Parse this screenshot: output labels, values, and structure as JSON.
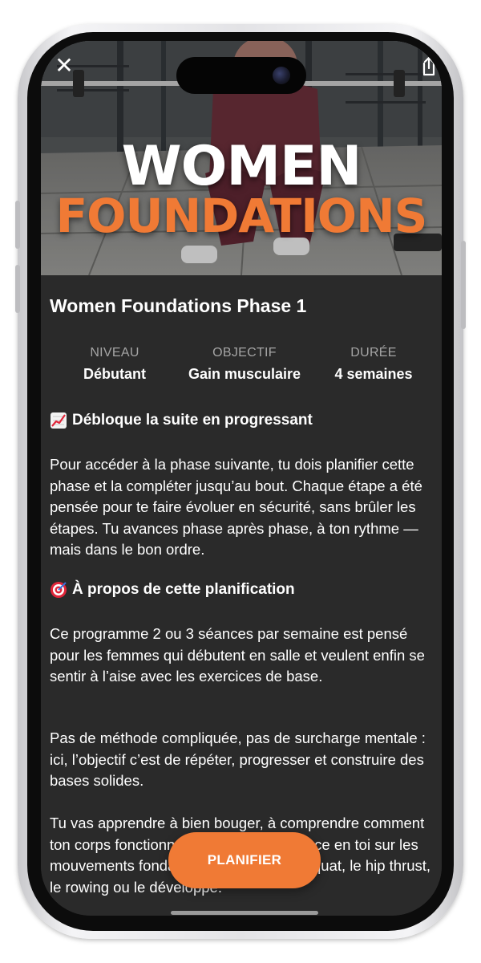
{
  "hero": {
    "title_line1": "WOMEN",
    "title_line2": "FOUNDATIONS",
    "accent_color": "#f07a35"
  },
  "icons": {
    "close": "close-icon",
    "share": "share-icon"
  },
  "program": {
    "title": "Women Foundations Phase 1",
    "stats": [
      {
        "label": "NIVEAU",
        "value": "Débutant"
      },
      {
        "label": "OBJECTIF",
        "value": "Gain musculaire"
      },
      {
        "label": "DURÉE",
        "value": "4 semaines"
      }
    ]
  },
  "sections": {
    "unlock": {
      "icon": "chart-increasing-emoji",
      "heading": "Débloque la suite en progressant",
      "body": "Pour accéder à la phase suivante, tu dois planifier cette phase et la compléter jusqu’au bout. Chaque étape a été pensée pour te faire évoluer en sécurité, sans brûler les étapes. Tu avances phase après phase, à ton rythme — mais dans le bon ordre."
    },
    "about": {
      "icon": "target-emoji",
      "heading": "À propos de cette planification",
      "body1": "Ce programme 2 ou 3 séances par semaine est pensé pour les femmes qui débutent en salle et veulent enfin se sentir à l’aise avec les exercices de base.",
      "body2": "Pas de méthode compliquée, pas de surcharge mentale : ici, l’objectif c’est de répéter, progresser et construire des bases solides.",
      "body3": "Tu vas apprendre à bien bouger, à comprendre comment ton corps fonctionne et à gagner confiance en toi sur les mouvements fondamentaux comme le squat, le hip thrust, le rowing ou le développé."
    }
  },
  "actions": {
    "plan_label": "PLANIFIER"
  }
}
